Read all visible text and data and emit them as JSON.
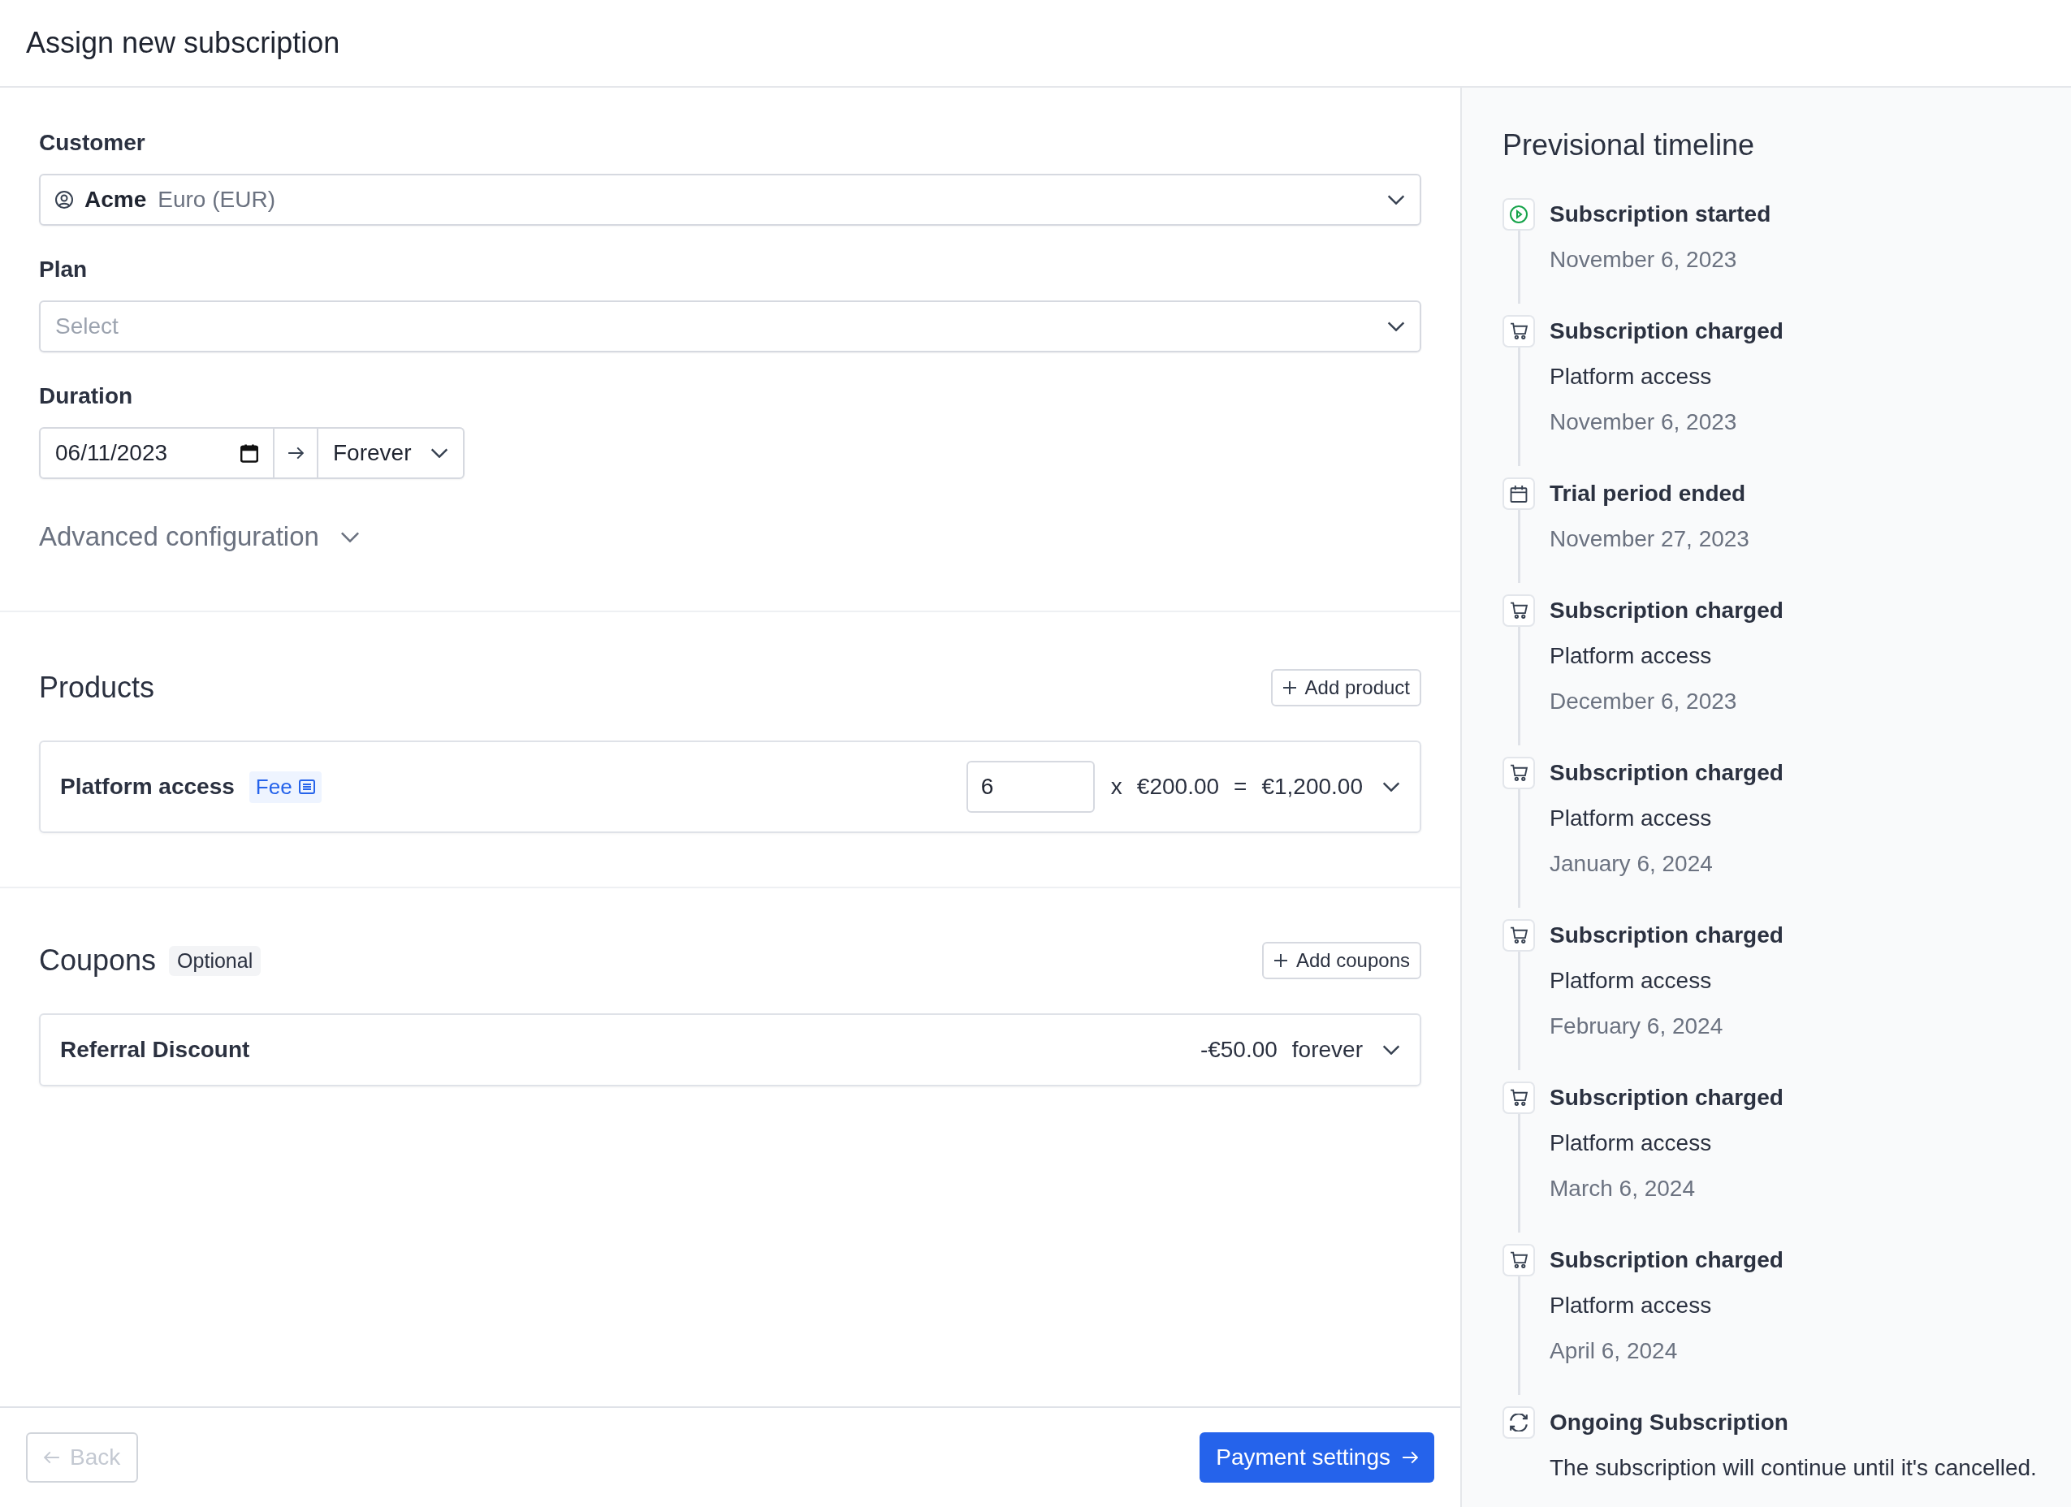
{
  "header": {
    "title": "Assign new subscription"
  },
  "form": {
    "customer": {
      "label": "Customer",
      "name": "Acme",
      "currency": "Euro (EUR)"
    },
    "plan": {
      "label": "Plan",
      "placeholder": "Select"
    },
    "duration": {
      "label": "Duration",
      "start": "06/11/2023",
      "end": "Forever"
    },
    "advanced": {
      "label": "Advanced configuration",
      "expanded": false
    }
  },
  "products": {
    "title": "Products",
    "add_button": "Add product",
    "items": [
      {
        "name": "Platform access",
        "tag": "Fee",
        "quantity": "6",
        "times": "x",
        "unit_price": "€200.00",
        "equals": "=",
        "total": "€1,200.00"
      }
    ]
  },
  "coupons": {
    "title": "Coupons",
    "badge": "Optional",
    "add_button": "Add coupons",
    "items": [
      {
        "name": "Referral Discount",
        "amount": "-€50.00",
        "period": "forever"
      }
    ]
  },
  "footer": {
    "back": {
      "label": "Back",
      "disabled": true
    },
    "next": {
      "label": "Payment settings"
    }
  },
  "timeline": {
    "title": "Previsional timeline",
    "events": [
      {
        "kind": "started",
        "title": "Subscription started",
        "date": "November 6, 2023"
      },
      {
        "kind": "charged",
        "title": "Subscription charged",
        "product": "Platform access",
        "date": "November 6, 2023"
      },
      {
        "kind": "trial",
        "title": "Trial period ended",
        "date": "November 27, 2023"
      },
      {
        "kind": "charged",
        "title": "Subscription charged",
        "product": "Platform access",
        "date": "December 6, 2023"
      },
      {
        "kind": "charged",
        "title": "Subscription charged",
        "product": "Platform access",
        "date": "January 6, 2024"
      },
      {
        "kind": "charged",
        "title": "Subscription charged",
        "product": "Platform access",
        "date": "February 6, 2024"
      },
      {
        "kind": "charged",
        "title": "Subscription charged",
        "product": "Platform access",
        "date": "March 6, 2024"
      },
      {
        "kind": "charged",
        "title": "Subscription charged",
        "product": "Platform access",
        "date": "April 6, 2024"
      },
      {
        "kind": "ongoing",
        "title": "Ongoing Subscription",
        "description": "The subscription will continue until it's cancelled."
      }
    ]
  }
}
